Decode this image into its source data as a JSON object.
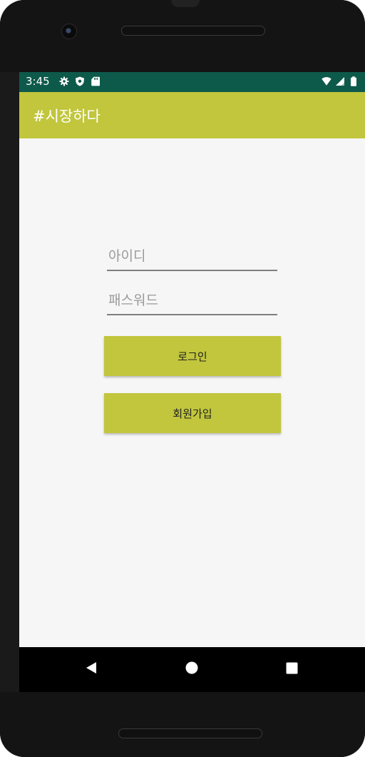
{
  "status_bar": {
    "time": "3:45",
    "left_icons": [
      "settings-icon",
      "shield-icon",
      "sd-card-icon"
    ],
    "right_icons": [
      "wifi-icon",
      "signal-icon",
      "battery-icon"
    ],
    "color": "#0d5a4b"
  },
  "app_bar": {
    "title": "#시장하다",
    "color": "#c1c63c"
  },
  "login_form": {
    "id_placeholder": "아이디",
    "id_value": "",
    "password_placeholder": "패스워드",
    "password_value": "",
    "login_label": "로그인",
    "signup_label": "회원가입",
    "button_color": "#c1c63c"
  },
  "nav_bar": {
    "buttons": [
      "back-icon",
      "home-icon",
      "recents-icon"
    ]
  }
}
